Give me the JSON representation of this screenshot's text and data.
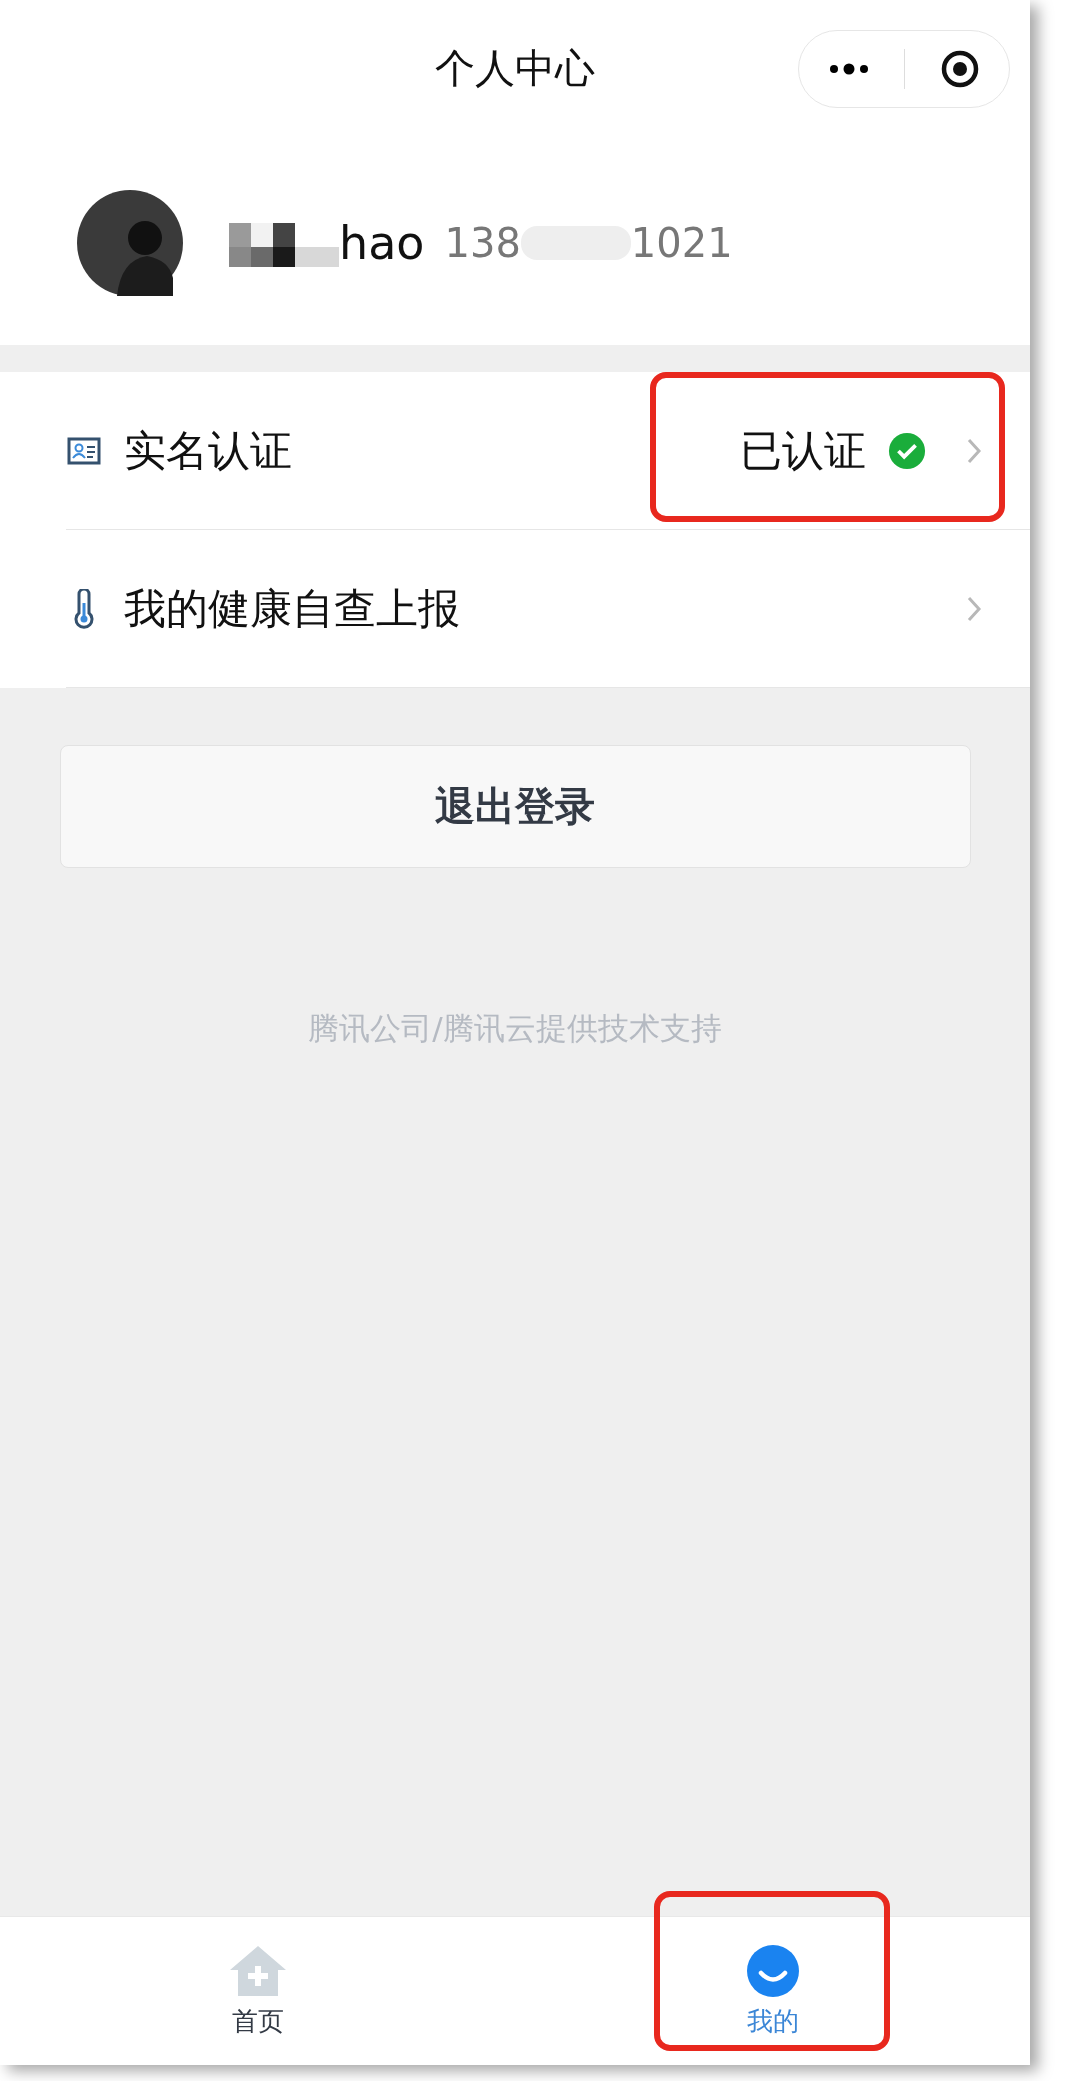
{
  "nav_bar": {
    "title": "个人中心"
  },
  "profile": {
    "name": "hao",
    "name_redacted": true,
    "phone_start": "138",
    "phone_end": "1021"
  },
  "menu": [
    {
      "kind": "id-card",
      "label": "实名认证",
      "status": "已认证",
      "verified": true,
      "highlighted": true
    },
    {
      "kind": "thermometer",
      "label": "我的健康自查上报",
      "highlighted": false
    }
  ],
  "logout_button": "退出登录",
  "footer": "腾讯公司/腾讯云提供技术支持",
  "tabs": [
    {
      "kind": "home",
      "label": "首页",
      "selected": false,
      "highlighted": false
    },
    {
      "kind": "me",
      "label": "我的",
      "selected": true,
      "highlighted": true
    }
  ]
}
